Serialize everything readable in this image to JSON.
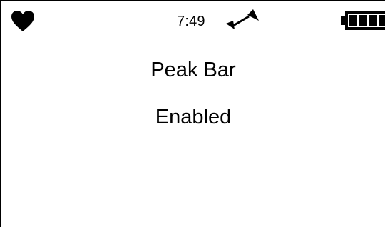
{
  "status_bar": {
    "time": "7:49",
    "heart_icon": "heart-icon",
    "signal_icon": "signal-icon",
    "battery_icon": "battery-icon"
  },
  "setting": {
    "title": "Peak Bar",
    "value": "Enabled"
  },
  "colors": {
    "foreground": "#000000",
    "background": "#ffffff"
  }
}
